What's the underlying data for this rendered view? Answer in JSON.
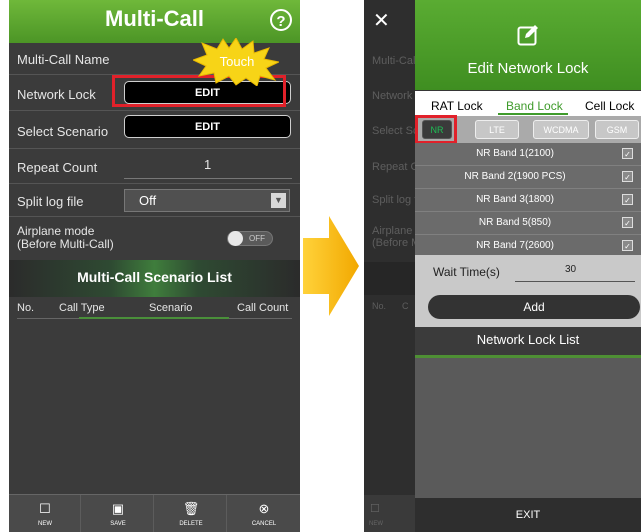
{
  "left": {
    "title": "Multi-Call",
    "rows": {
      "name_label": "Multi-Call Name",
      "network_lock_label": "Network Lock",
      "network_lock_button": "EDIT",
      "scenario_label": "Select Scenario",
      "scenario_button": "EDIT",
      "repeat_label": "Repeat Count",
      "repeat_value": "1",
      "split_label": "Split log file",
      "split_value": "Off",
      "airplane_label_1": "Airplane mode",
      "airplane_label_2": "(Before Multi-Call)",
      "airplane_toggle": "OFF"
    },
    "touch_callout": "Touch",
    "scenario_list_title": "Multi-Call Scenario List",
    "columns": [
      "No.",
      "Call Type",
      "Scenario",
      "Call Count"
    ],
    "footer": [
      {
        "label": "NEW",
        "icon": "new-icon"
      },
      {
        "label": "SAVE",
        "icon": "save-icon"
      },
      {
        "label": "DELETE",
        "icon": "trash-icon"
      },
      {
        "label": "CANCEL",
        "icon": "cancel-icon"
      }
    ]
  },
  "right": {
    "background": {
      "labels": [
        "Multi-Cal",
        "Network",
        "Select Sc",
        "Repeat C",
        "Split log f",
        "Airplane",
        "(Before M",
        "No.",
        "C"
      ],
      "footer_new": "NEW"
    },
    "dialog_title": "Edit Network Lock",
    "tabs": [
      "RAT Lock",
      "Band Lock",
      "Cell Lock"
    ],
    "active_tab": "Band Lock",
    "bands": [
      "NR",
      "LTE",
      "WCDMA",
      "GSM"
    ],
    "selected_band": "NR",
    "band_list": [
      "NR Band 1(2100)",
      "NR Band 2(1900 PCS)",
      "NR Band 3(1800)",
      "NR Band 5(850)",
      "NR Band 7(2600)"
    ],
    "wait_label": "Wait Time(s)",
    "wait_value": "30",
    "add_button": "Add",
    "list_title": "Network Lock List",
    "exit_button": "EXIT"
  },
  "colors": {
    "header_green": "#4c9526",
    "highlight_red": "#e1212a",
    "arrow_yellow": "#f5b800",
    "active_tab_green": "#3f9b2b"
  }
}
